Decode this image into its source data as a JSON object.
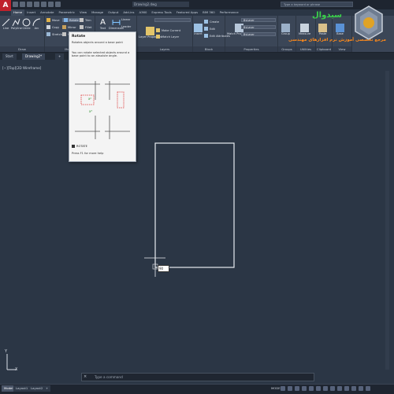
{
  "app_icon": "A",
  "document_title": "Drawing2.dwg",
  "search": {
    "placeholder": "Type a keyword or phrase"
  },
  "ribbon_tabs": [
    "Home",
    "Insert",
    "Annotate",
    "Parametric",
    "View",
    "Manage",
    "Output",
    "Add-ins",
    "A360",
    "Express Tools",
    "Featured Apps",
    "BIM 360",
    "Performance"
  ],
  "draw_tools": [
    "Line",
    "Polyline",
    "Circle",
    "Arc"
  ],
  "modify_tools": [
    "Move",
    "Rotate",
    "Trim",
    "Copy",
    "Mirror",
    "Fillet",
    "Stretch",
    "Scale",
    "Array"
  ],
  "annotation_tools": [
    "Text",
    "Dimension",
    "Linear",
    "Leader",
    "Table"
  ],
  "layer_tools": [
    "Layer Properties",
    "Make Current",
    "Match Layer"
  ],
  "block_tools": [
    "Insert",
    "Create",
    "Edit",
    "Edit Attributes"
  ],
  "properties": {
    "match": "Match Properties",
    "color": "ByLayer",
    "lineweight": "ByLayer",
    "linetype": "ByLayer"
  },
  "group_tools": [
    "Group"
  ],
  "utilities_tools": [
    "Measure"
  ],
  "clipboard_tools": [
    "Paste"
  ],
  "view_tools": [
    "Base"
  ],
  "group_labels": [
    "Draw",
    "Modify",
    "Annotation",
    "Layers",
    "Block",
    "Properties",
    "Groups",
    "Utilities",
    "Clipboard",
    "View"
  ],
  "file_tabs": [
    "Start",
    "Drawing2*",
    "+"
  ],
  "viewport_label": "[−][Top][2D Wireframe]",
  "tooltip": {
    "title": "Rotate",
    "description": "Rotates objects around a base point",
    "description2": "You can rotate selected objects around a base point to an absolute angle.",
    "command": "ROTATE",
    "help": "Press F1 for more help"
  },
  "dim_input": "90",
  "ucs": {
    "x": "X",
    "y": "Y"
  },
  "command_line": {
    "close": "×",
    "placeholder": "Type a command"
  },
  "layout_tabs": [
    "Model",
    "Layout1",
    "Layout2",
    "+"
  ],
  "status": {
    "model": "MODEL"
  },
  "brand": {
    "name": "سیدوال",
    "tagline": "مرجع تخصصی آموزش نرم افزارهای مهندسی"
  },
  "colors": {
    "viewport_bg": "#2b3645",
    "ribbon_bg": "#3b4657",
    "app_red": "#c0212b",
    "brand_green": "#3ad24a",
    "brand_orange": "#ff8a1a"
  }
}
